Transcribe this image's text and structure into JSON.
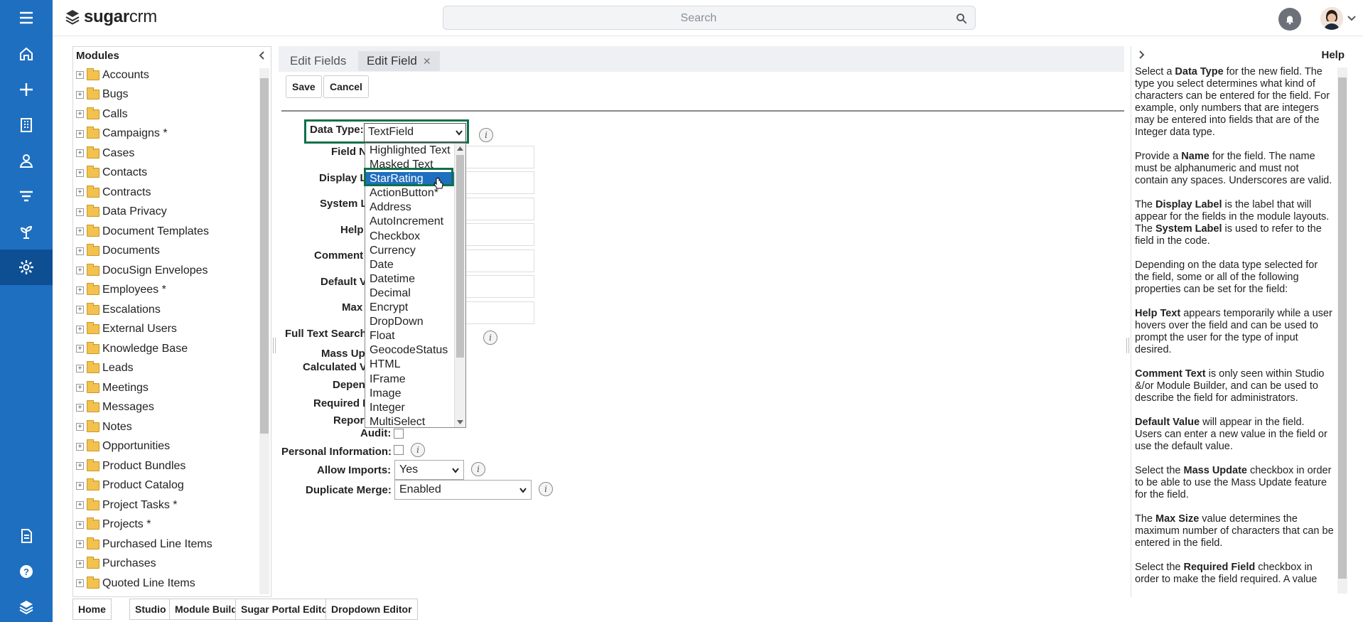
{
  "header": {
    "logo_text_bold": "sugar",
    "logo_text": "crm",
    "search_placeholder": "Search"
  },
  "rail": {
    "items": [
      "menu-icon",
      "home-icon",
      "plus-icon",
      "building-icon",
      "person-icon",
      "filter-icon",
      "plant-icon",
      "gear-icon",
      "document-icon",
      "help-icon",
      "layers-icon"
    ],
    "active": "gear-icon"
  },
  "modules": {
    "title": "Modules",
    "items": [
      "Accounts",
      "Bugs",
      "Calls",
      "Campaigns *",
      "Cases",
      "Contacts",
      "Contracts",
      "Data Privacy",
      "Document Templates",
      "Documents",
      "DocuSign Envelopes",
      "Employees *",
      "Escalations",
      "External Users",
      "Knowledge Base",
      "Leads",
      "Meetings",
      "Messages",
      "Notes",
      "Opportunities",
      "Product Bundles",
      "Product Catalog",
      "Project Tasks *",
      "Projects *",
      "Purchased Line Items",
      "Purchases",
      "Quoted Line Items"
    ]
  },
  "tabs": {
    "edit_fields": "Edit Fields",
    "edit_field": "Edit Field",
    "close": "✕"
  },
  "actions": {
    "save": "Save",
    "cancel": "Cancel"
  },
  "form": {
    "data_type_label": "Data Type:",
    "data_type_value": "TextField",
    "labels": {
      "field_name": "Field N",
      "display_label": "Display L",
      "system_label": "System L",
      "help": "Help",
      "comment": "Comment",
      "default_value": "Default V",
      "max": "Max",
      "full_text_search": "Full Text Search",
      "mass_update": "Mass Up",
      "calculated": "Calculated V",
      "dependent": "Depen",
      "required": "Required F",
      "reportable": "Report",
      "audit": "Audit:",
      "personal_info": "Personal Information:",
      "allow_imports": "Allow Imports:",
      "duplicate_merge": "Duplicate Merge:"
    },
    "allow_imports_value": "Yes",
    "duplicate_merge_value": "Enabled",
    "info_glyph": "i"
  },
  "dropdown": {
    "selected": "StarRating",
    "options": [
      "Highlighted Text",
      "Masked Text",
      "StarRating",
      "ActionButton*",
      "Address",
      "AutoIncrement",
      "Checkbox",
      "Currency",
      "Date",
      "Datetime",
      "Decimal",
      "Encrypt",
      "DropDown",
      "Float",
      "GeocodeStatus",
      "HTML",
      "IFrame",
      "Image",
      "Integer",
      "MultiSelect"
    ]
  },
  "help": {
    "title": "Help",
    "paragraphs": [
      [
        {
          "t": "Select a "
        },
        {
          "b": "Data Type"
        },
        {
          "t": " for the new field. The type you select determines what kind of characters can be entered for the field. For example, only numbers that are integers may be entered into fields that are of the Integer data type."
        }
      ],
      [
        {
          "t": "Provide a "
        },
        {
          "b": "Name"
        },
        {
          "t": " for the field. The name must be alphanumeric and must not contain any spaces. Underscores are valid."
        }
      ],
      [
        {
          "t": "The "
        },
        {
          "b": "Display Label"
        },
        {
          "t": " is the label that will appear for the fields in the module layouts. The "
        },
        {
          "b": "System Label"
        },
        {
          "t": " is used to refer to the field in the code."
        }
      ],
      [
        {
          "t": "Depending on the data type selected for the field, some or all of the following properties can be set for the field:"
        }
      ],
      [
        {
          "b": "Help Text"
        },
        {
          "t": " appears temporarily while a user hovers over the field and can be used to prompt the user for the type of input desired."
        }
      ],
      [
        {
          "b": "Comment Text"
        },
        {
          "t": " is only seen within Studio &/or Module Builder, and can be used to describe the field for administrators."
        }
      ],
      [
        {
          "b": "Default Value"
        },
        {
          "t": " will appear in the field. Users can enter a new value in the field or use the default value."
        }
      ],
      [
        {
          "t": "Select the "
        },
        {
          "b": "Mass Update"
        },
        {
          "t": " checkbox in order to be able to use the Mass Update feature for the field."
        }
      ],
      [
        {
          "t": "The "
        },
        {
          "b": "Max Size"
        },
        {
          "t": " value determines the maximum number of characters that can be entered in the field."
        }
      ],
      [
        {
          "t": "Select the "
        },
        {
          "b": "Required Field"
        },
        {
          "t": " checkbox in order to make the field required. A value"
        }
      ]
    ]
  },
  "footer": {
    "buttons": [
      "Home",
      "Studio",
      "Module Builder",
      "Sugar Portal Editor",
      "Dropdown Editor"
    ]
  },
  "colors": {
    "rail": "#1f6fc0",
    "rail_active": "#0e4f94",
    "highlight_box": "#10704a",
    "selected_option": "#1f6fc0"
  }
}
